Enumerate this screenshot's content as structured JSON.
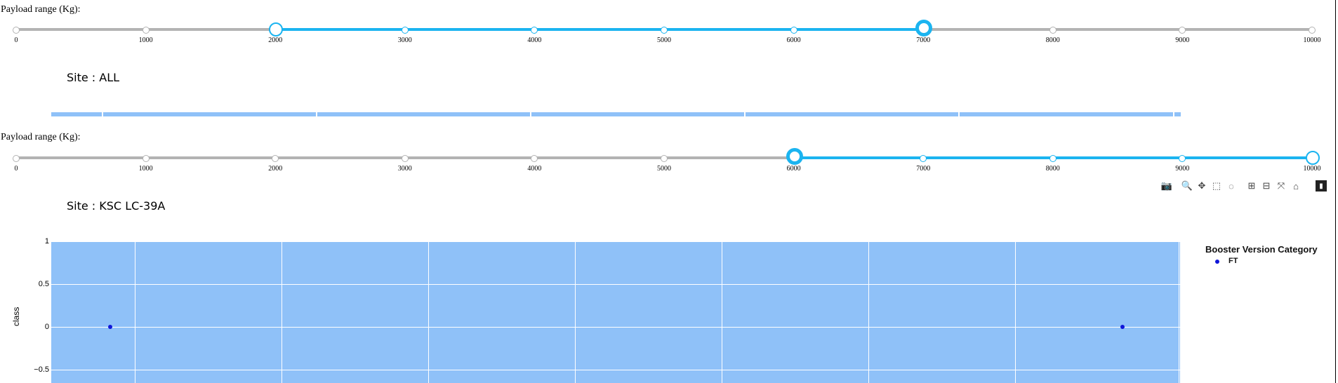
{
  "slider1": {
    "label": "Payload range (Kg):",
    "ticks": [
      "0",
      "1000",
      "2000",
      "3000",
      "4000",
      "5000",
      "6000",
      "7000",
      "8000",
      "9000",
      "10000"
    ],
    "range": [
      2000,
      7000
    ],
    "max": 10000
  },
  "site1": {
    "title": "Site : ALL"
  },
  "slider2": {
    "label": "Payload range (Kg):",
    "ticks": [
      "0",
      "1000",
      "2000",
      "3000",
      "4000",
      "5000",
      "6000",
      "7000",
      "8000",
      "9000",
      "10000"
    ],
    "range": [
      6000,
      10000
    ],
    "max": 10000
  },
  "modebar": {
    "icons": [
      "camera-icon",
      "zoom-icon",
      "pan-icon",
      "box-select-icon",
      "lasso-icon",
      "zoom-in-icon",
      "zoom-out-icon",
      "autoscale-icon",
      "reset-axes-icon",
      "plotly-logo-icon"
    ]
  },
  "site2": {
    "title": "Site : KSC LC-39A"
  },
  "chart_data": {
    "type": "scatter",
    "ylabel": "class",
    "yticks": [
      "1",
      "0.5",
      "0",
      "−0.5"
    ],
    "ylim": [
      -0.65,
      1
    ],
    "series": [
      {
        "name": "FT",
        "color": "#1016d9",
        "points": [
          {
            "x_frac": 0.052,
            "y": 0
          },
          {
            "x_frac": 0.949,
            "y": 0
          }
        ]
      }
    ],
    "legend": {
      "title": "Booster Version Category",
      "items": [
        "FT"
      ]
    },
    "plot_color": "#8fc1f8"
  }
}
